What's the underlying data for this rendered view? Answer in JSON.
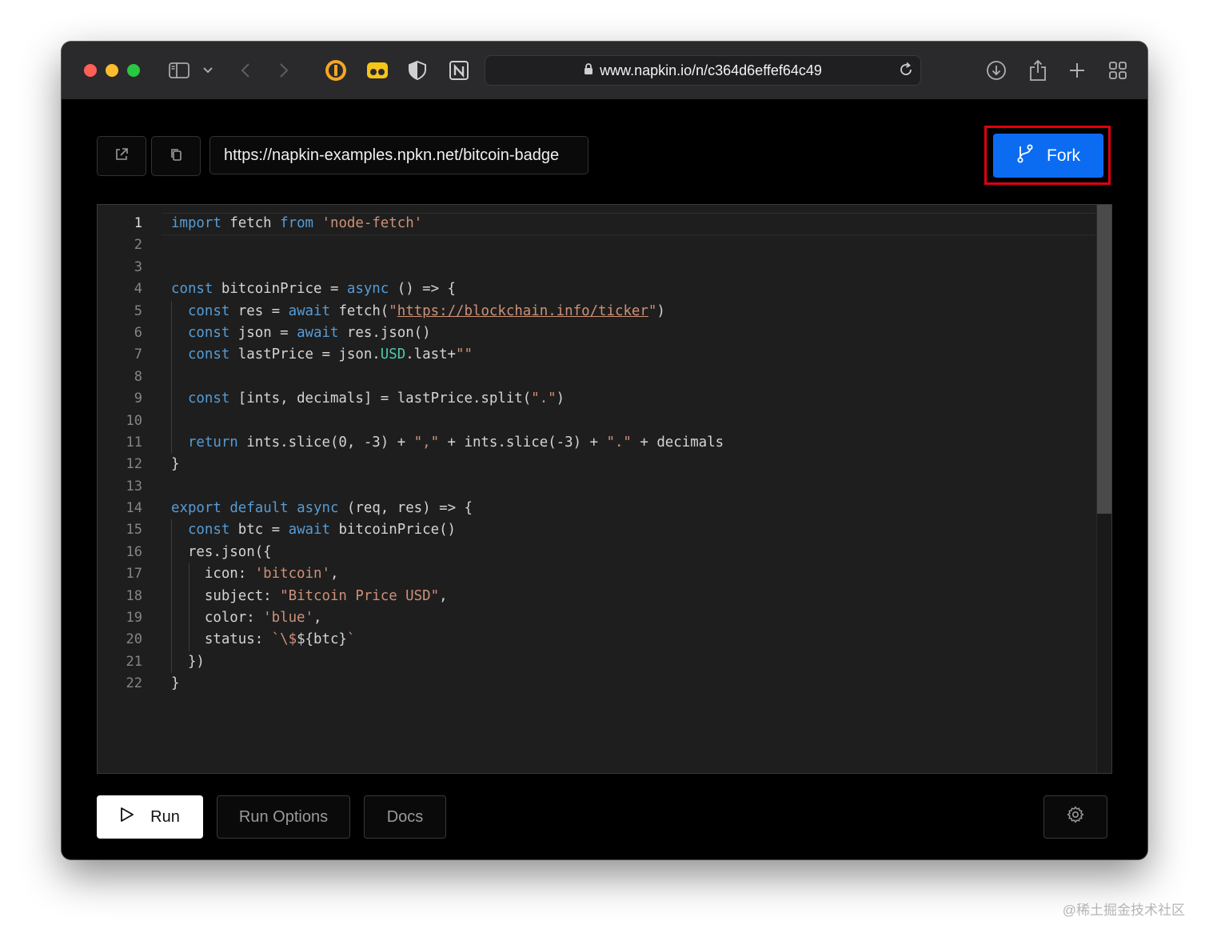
{
  "browser": {
    "url": "www.napkin.io/n/c364d6effef64c49"
  },
  "toolbar": {
    "endpoint_url": "https://napkin-examples.npkn.net/bitcoin-badge",
    "fork_label": "Fork"
  },
  "editor": {
    "line_numbers": [
      "1",
      "2",
      "3",
      "4",
      "5",
      "6",
      "7",
      "8",
      "9",
      "10",
      "11",
      "12",
      "13",
      "14",
      "15",
      "16",
      "17",
      "18",
      "19",
      "20",
      "21",
      "22"
    ],
    "active_line": 1,
    "lines": [
      [
        {
          "t": "import",
          "c": "kw"
        },
        {
          "t": " fetch ",
          "c": "p"
        },
        {
          "t": "from",
          "c": "kw"
        },
        {
          "t": " ",
          "c": "p"
        },
        {
          "t": "'node-fetch'",
          "c": "str"
        }
      ],
      [],
      [],
      [
        {
          "t": "const",
          "c": "kw"
        },
        {
          "t": " bitcoinPrice = ",
          "c": "p"
        },
        {
          "t": "async",
          "c": "kw"
        },
        {
          "t": " () => {",
          "c": "p"
        }
      ],
      [
        {
          "t": "  ",
          "c": "p"
        },
        {
          "t": "const",
          "c": "kw"
        },
        {
          "t": " res = ",
          "c": "p"
        },
        {
          "t": "await",
          "c": "kw"
        },
        {
          "t": " fetch(",
          "c": "p"
        },
        {
          "t": "\"",
          "c": "str"
        },
        {
          "t": "https://blockchain.info/ticker",
          "c": "url"
        },
        {
          "t": "\"",
          "c": "str"
        },
        {
          "t": ")",
          "c": "p"
        }
      ],
      [
        {
          "t": "  ",
          "c": "p"
        },
        {
          "t": "const",
          "c": "kw"
        },
        {
          "t": " json = ",
          "c": "p"
        },
        {
          "t": "await",
          "c": "kw"
        },
        {
          "t": " res.json()",
          "c": "p"
        }
      ],
      [
        {
          "t": "  ",
          "c": "p"
        },
        {
          "t": "const",
          "c": "kw"
        },
        {
          "t": " lastPrice = json.",
          "c": "p"
        },
        {
          "t": "USD",
          "c": "id"
        },
        {
          "t": ".last+",
          "c": "p"
        },
        {
          "t": "\"\"",
          "c": "str"
        }
      ],
      [],
      [
        {
          "t": "  ",
          "c": "p"
        },
        {
          "t": "const",
          "c": "kw"
        },
        {
          "t": " [ints, decimals] = lastPrice.split(",
          "c": "p"
        },
        {
          "t": "\".\"",
          "c": "str"
        },
        {
          "t": ")",
          "c": "p"
        }
      ],
      [],
      [
        {
          "t": "  ",
          "c": "p"
        },
        {
          "t": "return",
          "c": "kw"
        },
        {
          "t": " ints.slice(0, -3) + ",
          "c": "p"
        },
        {
          "t": "\",\"",
          "c": "str"
        },
        {
          "t": " + ints.slice(-3) + ",
          "c": "p"
        },
        {
          "t": "\".\"",
          "c": "str"
        },
        {
          "t": " + decimals",
          "c": "p"
        }
      ],
      [
        {
          "t": "}",
          "c": "p"
        }
      ],
      [],
      [
        {
          "t": "export",
          "c": "kw"
        },
        {
          "t": " ",
          "c": "p"
        },
        {
          "t": "default",
          "c": "kw"
        },
        {
          "t": " ",
          "c": "p"
        },
        {
          "t": "async",
          "c": "kw"
        },
        {
          "t": " (req, res) => {",
          "c": "p"
        }
      ],
      [
        {
          "t": "  ",
          "c": "p"
        },
        {
          "t": "const",
          "c": "kw"
        },
        {
          "t": " btc = ",
          "c": "p"
        },
        {
          "t": "await",
          "c": "kw"
        },
        {
          "t": " bitcoinPrice()",
          "c": "p"
        }
      ],
      [
        {
          "t": "  res.json({",
          "c": "p"
        }
      ],
      [
        {
          "t": "    icon: ",
          "c": "p"
        },
        {
          "t": "'bitcoin'",
          "c": "str"
        },
        {
          "t": ",",
          "c": "p"
        }
      ],
      [
        {
          "t": "    subject: ",
          "c": "p"
        },
        {
          "t": "\"Bitcoin Price USD\"",
          "c": "str"
        },
        {
          "t": ",",
          "c": "p"
        }
      ],
      [
        {
          "t": "    color: ",
          "c": "p"
        },
        {
          "t": "'blue'",
          "c": "str"
        },
        {
          "t": ",",
          "c": "p"
        }
      ],
      [
        {
          "t": "    status: ",
          "c": "p"
        },
        {
          "t": "`\\$",
          "c": "str"
        },
        {
          "t": "${btc}",
          "c": "p"
        },
        {
          "t": "`",
          "c": "str"
        }
      ],
      [
        {
          "t": "  })",
          "c": "p"
        }
      ],
      [
        {
          "t": "}",
          "c": "p"
        }
      ]
    ]
  },
  "bottom": {
    "run_label": "Run",
    "run_options_label": "Run Options",
    "docs_label": "Docs"
  },
  "watermark": "@稀土掘金技术社区",
  "icons": {
    "titlebar": [
      "sidebar-icon",
      "chevron-down-icon",
      "back-icon",
      "forward-icon",
      "1password-icon",
      "privacy-icon",
      "shield-icon",
      "notion-icon",
      "lock-icon",
      "reload-icon",
      "download-icon",
      "share-icon",
      "new-tab-icon",
      "tab-overview-icon"
    ],
    "toolbar": [
      "external-link-icon",
      "copy-icon",
      "git-fork-icon"
    ],
    "bottom": [
      "play-icon",
      "gear-icon"
    ]
  },
  "colors": {
    "fork_button": "#0b6cf2",
    "highlight_box": "#e0000f",
    "keyword": "#569cd6",
    "string": "#ce9178",
    "identifier": "#4ec9b0"
  }
}
